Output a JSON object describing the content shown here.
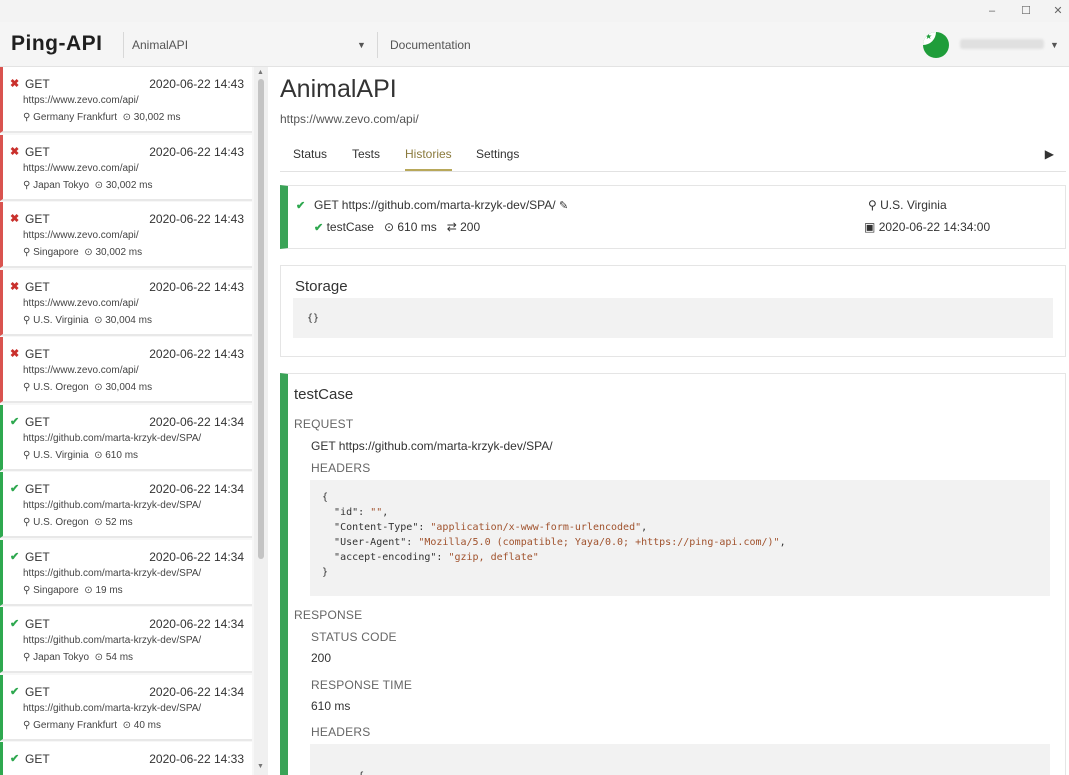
{
  "window": {
    "minimize": "–",
    "maximize": "☐",
    "close": "✕"
  },
  "header": {
    "logo": "Ping-API",
    "project": "AnimalAPI",
    "docs": "Documentation",
    "brand_color": "#1f9d3a"
  },
  "history": [
    {
      "status": "fail",
      "icon": "✖",
      "method": "GET",
      "time": "2020-06-22 14:43",
      "url": "https://www.zevo.com/api/",
      "location": "Germany Frankfurt",
      "duration": "30,002 ms"
    },
    {
      "status": "fail",
      "icon": "✖",
      "method": "GET",
      "time": "2020-06-22 14:43",
      "url": "https://www.zevo.com/api/",
      "location": "Japan Tokyo",
      "duration": "30,002 ms"
    },
    {
      "status": "fail",
      "icon": "✖",
      "method": "GET",
      "time": "2020-06-22 14:43",
      "url": "https://www.zevo.com/api/",
      "location": "Singapore",
      "duration": "30,002 ms"
    },
    {
      "status": "fail",
      "icon": "✖",
      "method": "GET",
      "time": "2020-06-22 14:43",
      "url": "https://www.zevo.com/api/",
      "location": "U.S. Virginia",
      "duration": "30,004 ms"
    },
    {
      "status": "fail",
      "icon": "✖",
      "method": "GET",
      "time": "2020-06-22 14:43",
      "url": "https://www.zevo.com/api/",
      "location": "U.S. Oregon",
      "duration": "30,004 ms"
    },
    {
      "status": "ok",
      "icon": "✔",
      "method": "GET",
      "time": "2020-06-22 14:34",
      "url": "https://github.com/marta-krzyk-dev/SPA/",
      "location": "U.S. Virginia",
      "duration": "610 ms"
    },
    {
      "status": "ok",
      "icon": "✔",
      "method": "GET",
      "time": "2020-06-22 14:34",
      "url": "https://github.com/marta-krzyk-dev/SPA/",
      "location": "U.S. Oregon",
      "duration": "52 ms"
    },
    {
      "status": "ok",
      "icon": "✔",
      "method": "GET",
      "time": "2020-06-22 14:34",
      "url": "https://github.com/marta-krzyk-dev/SPA/",
      "location": "Singapore",
      "duration": "19 ms"
    },
    {
      "status": "ok",
      "icon": "✔",
      "method": "GET",
      "time": "2020-06-22 14:34",
      "url": "https://github.com/marta-krzyk-dev/SPA/",
      "location": "Japan Tokyo",
      "duration": "54 ms"
    },
    {
      "status": "ok",
      "icon": "✔",
      "method": "GET",
      "time": "2020-06-22 14:34",
      "url": "https://github.com/marta-krzyk-dev/SPA/",
      "location": "Germany Frankfurt",
      "duration": "40 ms"
    },
    {
      "status": "ok",
      "icon": "✔",
      "method": "GET",
      "time": "2020-06-22 14:33",
      "url": "",
      "location": "",
      "duration": ""
    }
  ],
  "main": {
    "title": "AnimalAPI",
    "url": "https://www.zevo.com/api/",
    "tabs": [
      "Status",
      "Tests",
      "Histories",
      "Settings"
    ],
    "active_tab": "Histories",
    "play_icon": "▶"
  },
  "run": {
    "request_line": "GET https://github.com/marta-krzyk-dev/SPA/",
    "test_name": "testCase",
    "duration": "610 ms",
    "status_code": "200",
    "location": "U.S. Virginia",
    "date": "2020-06-22 14:34:00"
  },
  "storage": {
    "title": "Storage",
    "value": "{}"
  },
  "testcase": {
    "title": "testCase",
    "request_label": "REQUEST",
    "request_line": "GET https://github.com/marta-krzyk-dev/SPA/",
    "headers_label": "HEADERS",
    "request_headers": [
      {
        "key": "\"id\"",
        "value": "\"\""
      },
      {
        "key": "\"Content-Type\"",
        "value": "\"application/x-www-form-urlencoded\""
      },
      {
        "key": "\"User-Agent\"",
        "value": "\"Mozilla/5.0 (compatible; Yaya/0.0; +https://ping-api.com/)\""
      },
      {
        "key": "\"accept-encoding\"",
        "value": "\"gzip, deflate\""
      }
    ],
    "response_label": "RESPONSE",
    "status_code_label": "STATUS CODE",
    "status_code": "200",
    "response_time_label": "RESPONSE TIME",
    "response_time": "610 ms",
    "response_headers_label": "HEADERS",
    "response_headers_open": "{"
  }
}
